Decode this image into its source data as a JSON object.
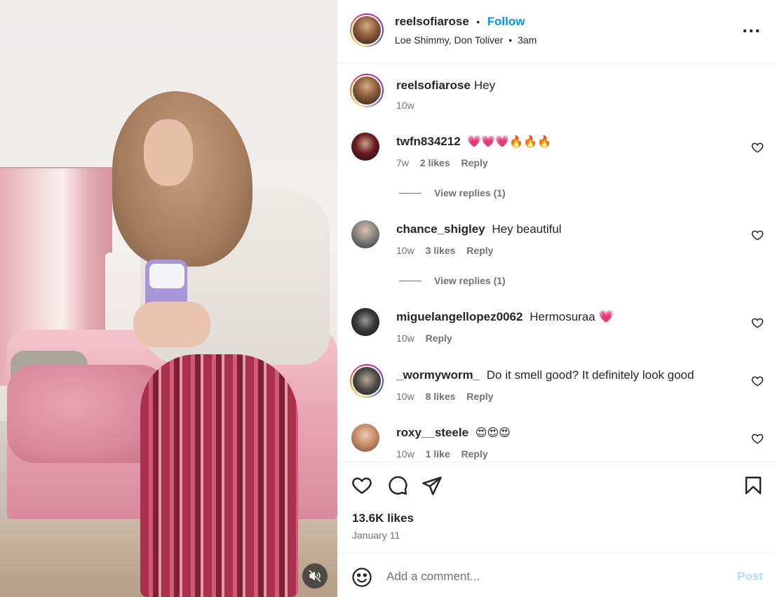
{
  "post": {
    "author": "reelsofiarose",
    "separator": "•",
    "follow_label": "Follow",
    "audio": "Loe Shimmy, Don Toliver",
    "audio_separator": "•",
    "time": "3am"
  },
  "caption": {
    "username": "reelsofiarose",
    "text": "Hey",
    "age": "10w"
  },
  "comments": [
    {
      "username": "twfn834212",
      "text": "💗💗💗🔥🔥🔥",
      "age": "7w",
      "likes": "2 likes",
      "reply": "Reply",
      "view_replies": "View replies (1)"
    },
    {
      "username": "chance_shigley",
      "text": "Hey beautiful",
      "age": "10w",
      "likes": "3 likes",
      "reply": "Reply",
      "view_replies": "View replies (1)"
    },
    {
      "username": "miguelangellopez0062",
      "text": "Hermosuraa 💗",
      "age": "10w",
      "reply": "Reply"
    },
    {
      "username": "_wormyworm_",
      "text": "Do it smell good? It definitely look good",
      "age": "10w",
      "likes": "8 likes",
      "reply": "Reply"
    },
    {
      "username": "roxy__steele",
      "text": "😍😍😍",
      "age": "10w",
      "likes": "1 like",
      "reply": "Reply"
    }
  ],
  "stats": {
    "likes": "13.6K likes",
    "date": "January 11"
  },
  "composer": {
    "placeholder": "Add a comment...",
    "post_label": "Post"
  },
  "icons": {
    "more": "more-horizontal-icon",
    "like": "heart-icon",
    "comment": "comment-icon",
    "share": "share-icon",
    "save": "bookmark-icon",
    "emoji": "emoji-icon",
    "mute": "muted-speaker-icon"
  },
  "colors": {
    "link_blue": "#0095f6",
    "post_disabled": "#b3dbff",
    "muted_text": "#737373"
  }
}
